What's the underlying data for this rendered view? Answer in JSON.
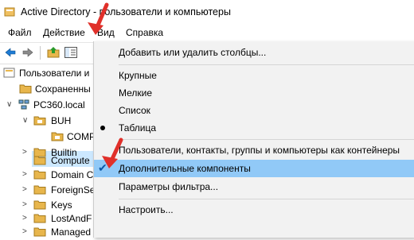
{
  "window": {
    "title": "Active Directory - пользователи и компьютеры"
  },
  "menubar": {
    "items": [
      "Файл",
      "Действие",
      "Вид",
      "Справка"
    ],
    "active": "Вид"
  },
  "tree": {
    "items": [
      {
        "label": "Пользователи и",
        "level": 0
      },
      {
        "label": "Сохраненны",
        "level": 1
      },
      {
        "label": "PC360.local",
        "level": 1
      },
      {
        "label": "BUH",
        "level": 2
      },
      {
        "label": "COMP",
        "level": 3
      },
      {
        "label": "Builtin",
        "level": 2
      },
      {
        "label": "Compute",
        "level": 2
      },
      {
        "label": "Domain C",
        "level": 2
      },
      {
        "label": "ForeignSe",
        "level": 2
      },
      {
        "label": "Keys",
        "level": 2
      },
      {
        "label": "LostAndF",
        "level": 2
      },
      {
        "label": "Managed Service Accounts",
        "level": 2
      }
    ]
  },
  "dropdown": {
    "items": [
      {
        "label": "Добавить или удалить столбцы...",
        "mark": ""
      },
      {
        "label": "Крупные",
        "mark": ""
      },
      {
        "label": "Мелкие",
        "mark": ""
      },
      {
        "label": "Список",
        "mark": ""
      },
      {
        "label": "Таблица",
        "mark": "bullet"
      },
      {
        "label": "Пользователи, контакты, группы и компьютеры как контейнеры",
        "mark": ""
      },
      {
        "label": "Дополнительные компоненты",
        "mark": "check"
      },
      {
        "label": "Параметры фильтра...",
        "mark": ""
      },
      {
        "label": "Настроить...",
        "mark": ""
      }
    ],
    "highlighted": "Дополнительные компоненты"
  },
  "colors": {
    "highlight": "#91c9f7",
    "menu_active": "#cce8ff",
    "annotation_arrow": "#e0302a",
    "folder": "#e8b64c"
  },
  "icons": [
    "app-icon",
    "back-arrow-icon",
    "forward-arrow-icon",
    "folder-up-icon",
    "console-tree-icon",
    "folder-icon",
    "bullet-icon",
    "checkmark-icon",
    "red-annotation-arrow"
  ]
}
